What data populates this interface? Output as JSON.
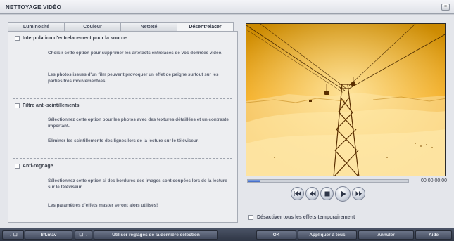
{
  "window": {
    "title": "NETTOYAGE VIDÉO",
    "close_label": "×"
  },
  "tabs": [
    {
      "label": "Luminosité",
      "active": false
    },
    {
      "label": "Couleur",
      "active": false
    },
    {
      "label": "Netteté",
      "active": false
    },
    {
      "label": "Désentrelacer",
      "active": true
    }
  ],
  "sections": [
    {
      "title": "Interpolation d'entrelacement pour la source",
      "checked": false,
      "paragraphs": [
        "Choisir cette option pour supprimer les artefacts entrelacés de vos données vidéo.",
        "Les photos issues d'un film peuvent provoquer un effet de peigne surtout sur les parties très mouvementées."
      ]
    },
    {
      "title": "Filtre anti-scintillements",
      "checked": false,
      "paragraphs": [
        "Sélectionnez cette option pour les photos avec des textures détaillées et un contraste important.",
        "Eliminer les scintillements des lignes lors de la lecture sur le téléviseur."
      ]
    },
    {
      "title": "Anti-rognage",
      "checked": false,
      "paragraphs": [
        "Sélectionnez cette option si des bordures des images sont coupées lors de la lecture sur le téléviseur.",
        "Les paramètres d'effets master seront alors utilisés!"
      ]
    }
  ],
  "player": {
    "timecode": "00:00:00:00",
    "progress": 0.08,
    "transport": [
      "skip-back-icon",
      "rewind-icon",
      "stop-icon",
      "play-icon",
      "fast-forward-icon"
    ]
  },
  "disable_effects_label": "Désactiver tous les effets temporairement",
  "bottom_bar": {
    "prev_icon": "←☐",
    "file_name": "lift.mav",
    "next_icon": "☐→",
    "use_last_selection_label": "Utiliser réglages de la dernière sélection",
    "ok_label": "OK",
    "apply_all_label": "Appliquer à tous",
    "cancel_label": "Annuler",
    "help_label": "Aide"
  },
  "colors": {
    "accent": "#3f68c6",
    "preview_sky": "#f7a81b",
    "preview_snow": "#fde3a0"
  }
}
